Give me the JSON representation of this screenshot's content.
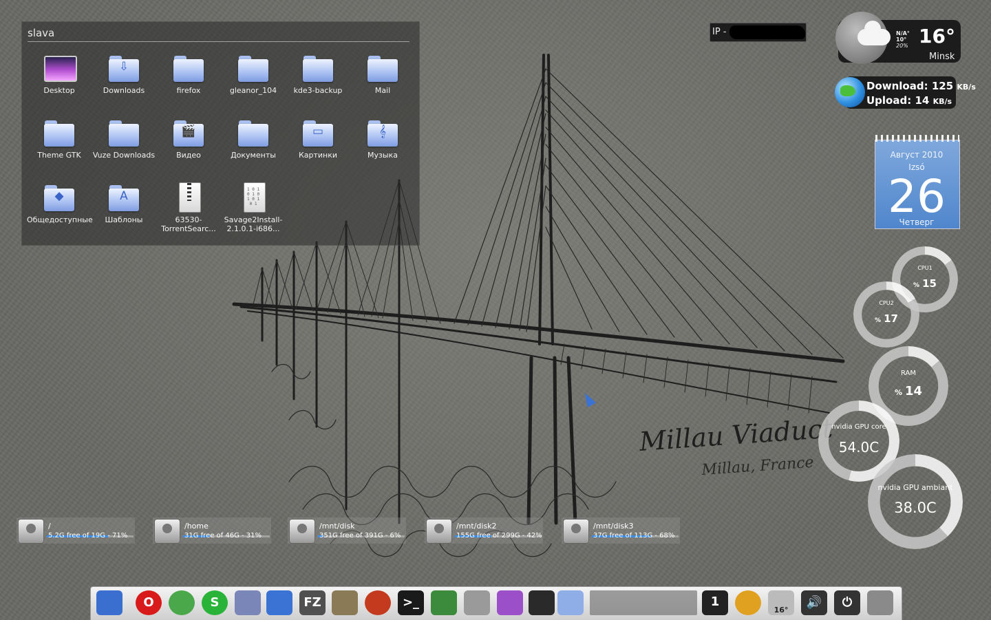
{
  "folder_view": {
    "title": "slava",
    "items": [
      {
        "label": "Desktop",
        "kind": "screen",
        "icon": "desktop-icon"
      },
      {
        "label": "Downloads",
        "kind": "folder",
        "icon": "downloads-folder-icon",
        "glyph": "⇩"
      },
      {
        "label": "firefox",
        "kind": "folder",
        "icon": "folder-icon"
      },
      {
        "label": "gleanor_104",
        "kind": "folder",
        "icon": "folder-icon"
      },
      {
        "label": "kde3-backup",
        "kind": "folder",
        "icon": "folder-icon"
      },
      {
        "label": "Mail",
        "kind": "folder",
        "icon": "folder-icon"
      },
      {
        "label": "Theme GTK",
        "kind": "folder",
        "icon": "folder-icon"
      },
      {
        "label": "Vuze Downloads",
        "kind": "folder",
        "icon": "folder-icon"
      },
      {
        "label": "Видео",
        "kind": "folder",
        "icon": "video-folder-icon",
        "glyph": "🎬"
      },
      {
        "label": "Документы",
        "kind": "folder",
        "icon": "documents-folder-icon"
      },
      {
        "label": "Картинки",
        "kind": "folder",
        "icon": "pictures-folder-icon",
        "glyph": "▭"
      },
      {
        "label": "Музыка",
        "kind": "folder",
        "icon": "music-folder-icon",
        "glyph": "𝄞"
      },
      {
        "label": "Общедоступные",
        "kind": "folder",
        "icon": "public-folder-icon",
        "glyph": "◆"
      },
      {
        "label": "Шаблоны",
        "kind": "folder",
        "icon": "templates-folder-icon",
        "glyph": "A"
      },
      {
        "label": "63530-TorrentSearc...",
        "kind": "zip",
        "icon": "zip-file-icon"
      },
      {
        "label": "Savage2Install-2.1.0.1-i686...",
        "kind": "bin",
        "icon": "binary-file-icon"
      }
    ]
  },
  "ip_widget": {
    "label": "IP -"
  },
  "weather": {
    "condition": "N/A°",
    "low": "10°",
    "chance": "20%",
    "temp": "16°",
    "city": "Minsk"
  },
  "network": {
    "download_label": "Download:",
    "download_value": "125",
    "upload_label": "Upload:",
    "upload_value": "14",
    "unit": "KB/s"
  },
  "calendar": {
    "month_year": "Август 2010",
    "name": "Izsó",
    "day": "26",
    "weekday": "Четверг"
  },
  "gauges": [
    {
      "name": "cpu1",
      "label": "CPU1",
      "unit": "%",
      "value": "15",
      "fraction": 0.15
    },
    {
      "name": "cpu2",
      "label": "CPU2",
      "unit": "%",
      "value": "17",
      "fraction": 0.17
    },
    {
      "name": "ram",
      "label": "RAM",
      "unit": "%",
      "value": "14",
      "fraction": 0.14
    },
    {
      "name": "gpu-core",
      "label": "nvidia GPU core",
      "unit": "",
      "value": "54.0C",
      "fraction": 0.54
    },
    {
      "name": "gpu-ambient",
      "label": "nvidia GPU ambiant",
      "unit": "",
      "value": "38.0C",
      "fraction": 0.38
    }
  ],
  "disks": [
    {
      "mount": "/",
      "free": "5.2G free of 19G - 71%",
      "used_pct": 71
    },
    {
      "mount": "/home",
      "free": "31G free of 46G - 31%",
      "used_pct": 31
    },
    {
      "mount": "/mnt/disk",
      "free": "351G free of 391G - 6%",
      "used_pct": 6
    },
    {
      "mount": "/mnt/disk2",
      "free": "155G free of 299G - 42%",
      "used_pct": 42
    },
    {
      "mount": "/mnt/disk3",
      "free": "37G free of 113G - 68%",
      "used_pct": 68
    }
  ],
  "wallpaper": {
    "caption1": "Millau Viaduct",
    "caption2": "Millau, France"
  },
  "dock": {
    "items": [
      {
        "name": "show-desktop-icon",
        "color": "#3b6fcf"
      },
      {
        "name": "opera-icon",
        "color": "#d81a1a",
        "glyph": "O"
      },
      {
        "name": "network-globe-icon",
        "color": "#4aa84a"
      },
      {
        "name": "skype-icon",
        "color": "#29b339",
        "glyph": "S"
      },
      {
        "name": "thunderbird-mail-icon",
        "color": "#7a86b8"
      },
      {
        "name": "pidgin-bird-icon",
        "color": "#3b73d4"
      },
      {
        "name": "filezilla-icon",
        "color": "#505050",
        "glyph": "FZ"
      },
      {
        "name": "gimp-icon",
        "color": "#8a7a55"
      },
      {
        "name": "media-burner-icon",
        "color": "#c33a1e"
      },
      {
        "name": "terminal-icon",
        "color": "#1a1a1a",
        "glyph": ">_"
      },
      {
        "name": "image-viewer-icon",
        "color": "#3c8a3c"
      },
      {
        "name": "screenshot-tool-icon",
        "color": "#9a9a9a"
      },
      {
        "name": "wallpaper-viewer-icon",
        "color": "#9b4fc8"
      },
      {
        "name": "gnome-foot-icon",
        "color": "#2a2a2a"
      },
      {
        "name": "folder-dock-icon",
        "color": "#8faee8"
      },
      {
        "name": "pager-icon",
        "color": "#777777"
      },
      {
        "name": "workspace-number-icon",
        "color": "#222222",
        "glyph": "1"
      },
      {
        "name": "clock-icon",
        "color": "#e0a020"
      },
      {
        "name": "weather-tray-icon",
        "color": "#bbbbbb",
        "glyph": "16°"
      },
      {
        "name": "volume-icon",
        "color": "#333333",
        "glyph": "🔊"
      },
      {
        "name": "power-icon",
        "color": "#333333",
        "glyph": "⏻"
      },
      {
        "name": "trash-icon",
        "color": "#8a8a8a"
      }
    ]
  }
}
